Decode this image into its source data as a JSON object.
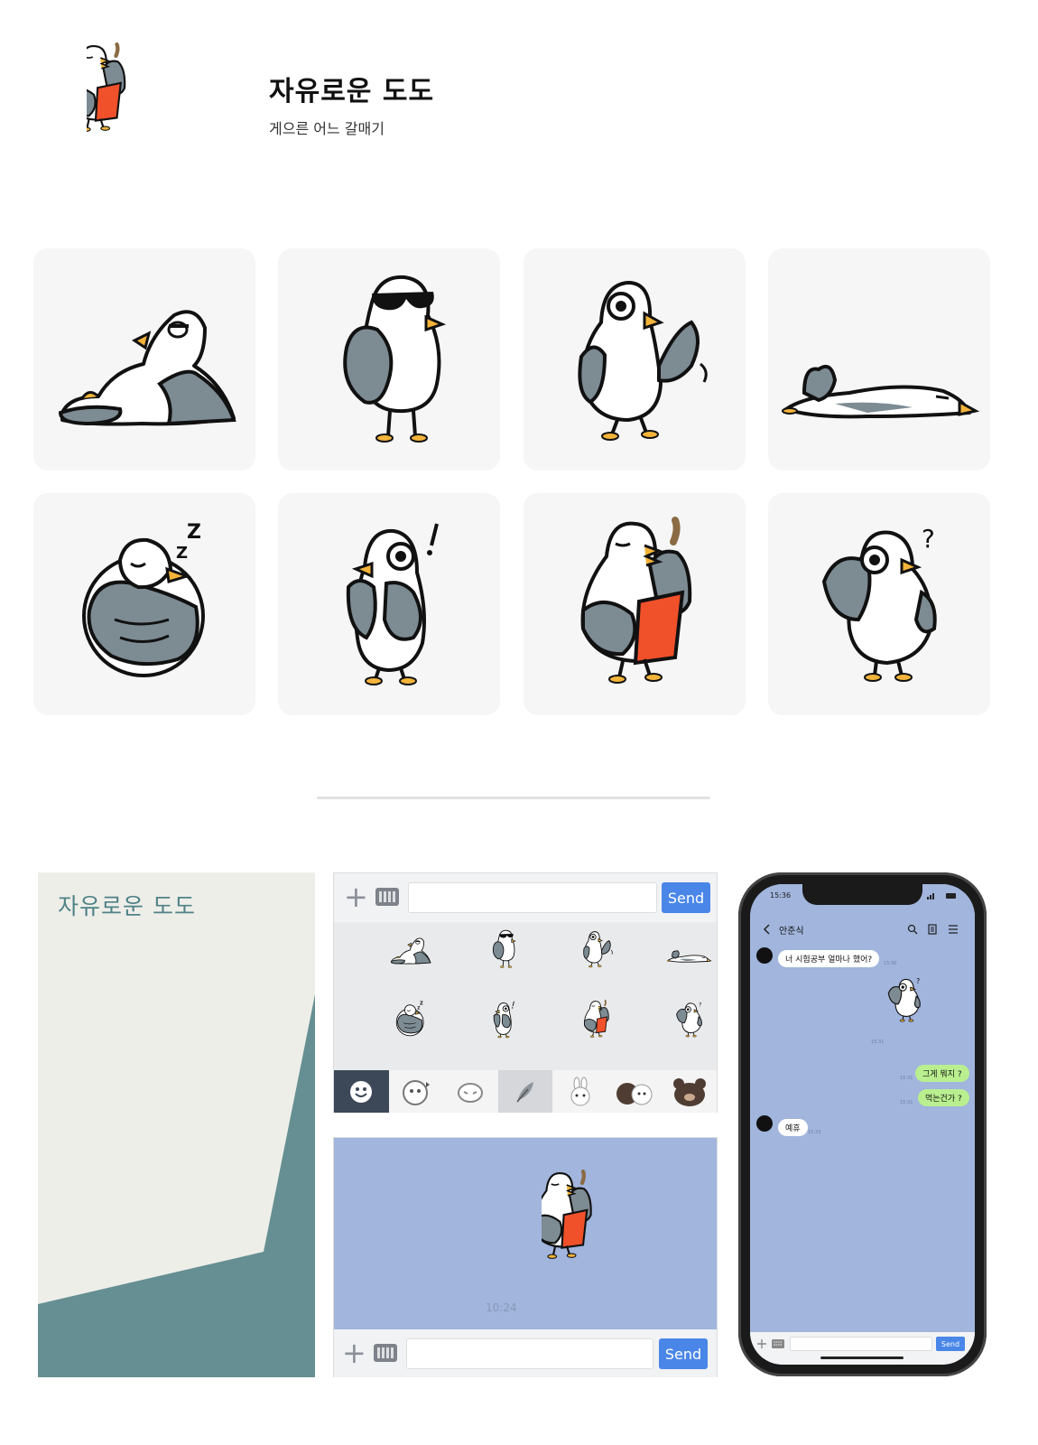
{
  "header": {
    "title": "자유로운 도도",
    "subtitle": "게으른 어느 갈매기"
  },
  "stickers": [
    {
      "id": "lounging"
    },
    {
      "id": "sunglasses"
    },
    {
      "id": "waving"
    },
    {
      "id": "lying-flat"
    },
    {
      "id": "sleeping"
    },
    {
      "id": "surprised"
    },
    {
      "id": "eating-snack"
    },
    {
      "id": "confused"
    }
  ],
  "poster": {
    "title": "자유로운 도도",
    "colors": {
      "background": "#eeeee9",
      "shadow": "#658f92",
      "title": "#4f8286"
    }
  },
  "keyboard": {
    "send_label": "Send",
    "plus_glyph": "+",
    "tabs": [
      "smile-icon",
      "sticker-pack-1",
      "sticker-pack-2",
      "dodo-pack",
      "bunny-pack",
      "bear-brown-pack",
      "bear-pack"
    ]
  },
  "chat_preview": {
    "timestamp": "10:24",
    "send_label": "Send",
    "colors": {
      "background": "#a1b5dd",
      "send": "#4a86e8"
    }
  },
  "phone": {
    "status_time": "15:36",
    "contact_name": "안준식",
    "messages": [
      {
        "side": "left",
        "text": "너 시험공부 얼마나 했어?",
        "time": "15:30"
      },
      {
        "side": "right",
        "type": "sticker",
        "time": "15:31"
      },
      {
        "side": "right",
        "text": "그게 뭐지 ?",
        "time": "15:31"
      },
      {
        "side": "right",
        "text": "먹는건가 ?",
        "time": "15:31"
      },
      {
        "side": "left",
        "text": "예휴",
        "time": "15:33"
      }
    ],
    "send_label": "Send"
  }
}
